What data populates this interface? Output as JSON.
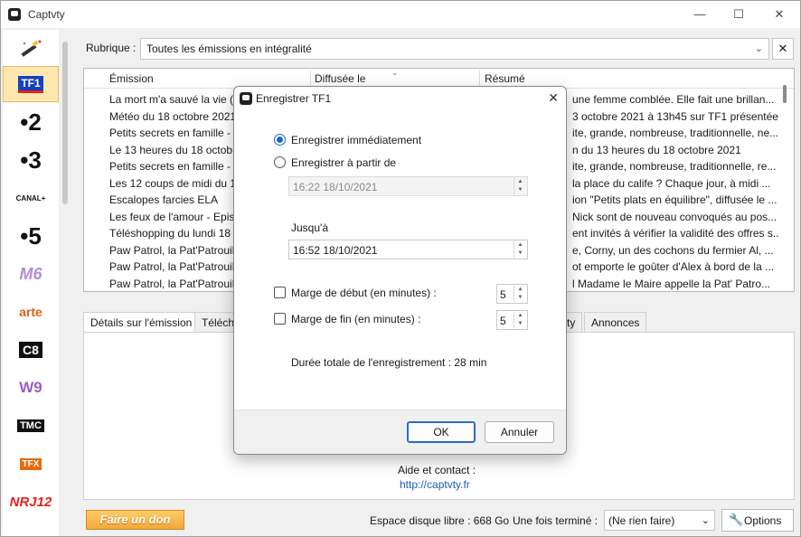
{
  "app": {
    "title": "Captvty"
  },
  "window_controls": {
    "minimize": "—",
    "maximize": "☐",
    "close": "✕"
  },
  "channels": [
    "TF1",
    "•2",
    "•3",
    "CANAL+",
    "•5",
    "M6",
    "arte",
    "C8",
    "W9",
    "TMC",
    "TFX",
    "NRJ12"
  ],
  "rubrique": {
    "label": "Rubrique :",
    "value": "Toutes les émissions en intégralité",
    "clear": "✕"
  },
  "table": {
    "headers": [
      "Émission",
      "Diffusée le",
      "Résumé"
    ],
    "rows": [
      {
        "emission": "La mort m'a sauvé la vie (a",
        "resume": "une femme comblée. Elle fait une brillan..."
      },
      {
        "emission": "Météo du 18 octobre 2021",
        "resume": "3 octobre 2021 à 13h45 sur TF1 présentée..."
      },
      {
        "emission": "Petits secrets en famille - F",
        "resume": "ite, grande, nombreuse, traditionnelle, ne..."
      },
      {
        "emission": "Le 13 heures du 18 octobre",
        "resume": "n du 13 heures du 18 octobre 2021"
      },
      {
        "emission": "Petits secrets en famille - F",
        "resume": "ite, grande, nombreuse, traditionnelle, re..."
      },
      {
        "emission": "Les 12 coups de midi du 18",
        "resume": "la place du calife ? Chaque jour, à midi ..."
      },
      {
        "emission": "Escalopes farcies ELA",
        "resume": "ion \"Petits plats en équilibre\", diffusée le ..."
      },
      {
        "emission": "Les feux de l'amour - Episo",
        "resume": "Nick sont de nouveau convoqués au pos..."
      },
      {
        "emission": "Téléshopping du lundi 18 o",
        "resume": "ent invités à vérifier la validité des offres s..."
      },
      {
        "emission": "Paw Patrol, la Pat'Patrouill",
        "resume": "e, Corny, un des cochons du fermier Al, ..."
      },
      {
        "emission": "Paw Patrol, la Pat'Patrouill",
        "resume": "ot emporte le goûter d'Alex à bord de la ..."
      },
      {
        "emission": "Paw Patrol, la Pat'Patrouill",
        "resume": "l Madame le Maire appelle la Pat' Patro..."
      }
    ]
  },
  "tabs": [
    "Détails sur l'émission",
    "Téléch",
    "ty",
    "Annonces"
  ],
  "help": {
    "label": "Aide et contact :",
    "link": "http://captvty.fr"
  },
  "footer": {
    "donate": "Faire un don",
    "disk": "Espace disque libre : 668 Go",
    "after_label": "Une fois terminé :",
    "after_value": "(Ne rien faire)",
    "options": "Options"
  },
  "dialog": {
    "title": "Enregistrer TF1",
    "close": "✕",
    "opt_now": "Enregistrer immédiatement",
    "opt_from": "Enregistrer à partir de",
    "from_value": "16:22 18/10/2021",
    "until_label": "Jusqu'à",
    "until_value": "16:52 18/10/2021",
    "margin_start_label": "Marge de début (en minutes) :",
    "margin_start_value": "5",
    "margin_end_label": "Marge de fin (en minutes) :",
    "margin_end_value": "5",
    "total": "Durée totale de l'enregistrement : 28 min",
    "ok": "OK",
    "cancel": "Annuler"
  },
  "colors": {
    "accent": "#1e66c8",
    "selected_channel": "#ffe8b0",
    "donate": "#f3a93a",
    "link": "#1a5fb4"
  }
}
